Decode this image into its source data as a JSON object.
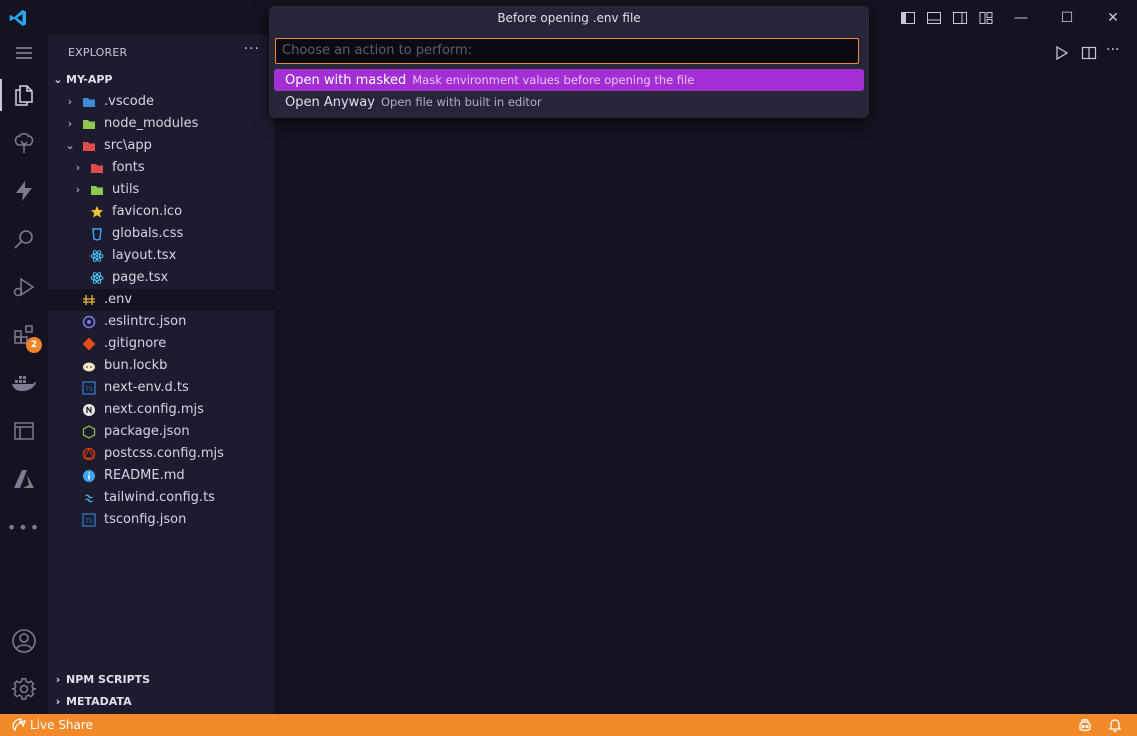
{
  "window": {
    "minimize": "—",
    "maximize": "☐",
    "close": "✕"
  },
  "activity_bar": {
    "items": [
      {
        "name": "explorer",
        "icon": "files-icon",
        "active": true
      },
      {
        "name": "source-control",
        "icon": "tree-icon"
      },
      {
        "name": "run",
        "icon": "lightning-icon"
      },
      {
        "name": "search",
        "icon": "search-icon"
      },
      {
        "name": "run-debug",
        "icon": "debug-icon"
      },
      {
        "name": "extensions",
        "icon": "extensions-icon",
        "badge": "2"
      },
      {
        "name": "docker",
        "icon": "docker-icon"
      },
      {
        "name": "remote",
        "icon": "window-icon"
      },
      {
        "name": "azure",
        "icon": "azure-icon"
      },
      {
        "name": "more",
        "icon": "ellipsis-icon"
      }
    ],
    "bottom": [
      {
        "name": "accounts",
        "icon": "account-icon"
      },
      {
        "name": "manage",
        "icon": "gear-icon"
      }
    ]
  },
  "sidebar": {
    "title": "EXPLORER",
    "more": "···",
    "project": "MY-APP",
    "tree": [
      {
        "label": ".vscode",
        "depth": 1,
        "chev": "›",
        "icon": "folder-vscode-icon",
        "color": "#3c8ad8"
      },
      {
        "label": "node_modules",
        "depth": 1,
        "chev": "›",
        "icon": "folder-node-icon",
        "color": "#8cc84b"
      },
      {
        "label": "src\\app",
        "depth": 1,
        "chev": "⌄",
        "icon": "folder-src-icon",
        "color": "#e24b4b"
      },
      {
        "label": "fonts",
        "depth": 2,
        "chev": "›",
        "icon": "folder-fonts-icon",
        "color": "#e24b4b"
      },
      {
        "label": "utils",
        "depth": 2,
        "chev": "›",
        "icon": "folder-utils-icon",
        "color": "#8cc84b"
      },
      {
        "label": "favicon.ico",
        "depth": 2,
        "icon": "star-icon",
        "color": "#f2c131"
      },
      {
        "label": "globals.css",
        "depth": 2,
        "icon": "css-icon",
        "color": "#42a5f5"
      },
      {
        "label": "layout.tsx",
        "depth": 2,
        "icon": "react-icon",
        "color": "#4fc3f7"
      },
      {
        "label": "page.tsx",
        "depth": 2,
        "icon": "react-icon",
        "color": "#4fc3f7"
      },
      {
        "label": ".env",
        "depth": 1,
        "icon": "env-icon",
        "color": "#f2c131",
        "selected": true
      },
      {
        "label": ".eslintrc.json",
        "depth": 1,
        "icon": "eslint-icon",
        "color": "#7a7ee8"
      },
      {
        "label": ".gitignore",
        "depth": 1,
        "icon": "git-icon",
        "color": "#e64a19"
      },
      {
        "label": "bun.lockb",
        "depth": 1,
        "icon": "bun-icon",
        "color": "#f5e6c8"
      },
      {
        "label": "next-env.d.ts",
        "depth": 1,
        "icon": "ts-icon",
        "color": "#3178c6"
      },
      {
        "label": "next.config.mjs",
        "depth": 1,
        "icon": "next-icon",
        "color": "#e8e8e8"
      },
      {
        "label": "package.json",
        "depth": 1,
        "icon": "nodejs-icon",
        "color": "#8cc84b"
      },
      {
        "label": "postcss.config.mjs",
        "depth": 1,
        "icon": "postcss-icon",
        "color": "#dd3a0a"
      },
      {
        "label": "README.md",
        "depth": 1,
        "icon": "info-icon",
        "color": "#42a5f5"
      },
      {
        "label": "tailwind.config.ts",
        "depth": 1,
        "icon": "tailwind-icon",
        "color": "#4fc3f7"
      },
      {
        "label": "tsconfig.json",
        "depth": 1,
        "icon": "tsconfig-icon",
        "color": "#3178c6"
      }
    ],
    "sections": [
      {
        "label": "NPM SCRIPTS"
      },
      {
        "label": "METADATA"
      }
    ]
  },
  "quick_pick": {
    "title": "Before opening .env file",
    "placeholder": "Choose an action to perform:",
    "value": "",
    "items": [
      {
        "label": "Open with masked",
        "description": "Mask environment values before opening the file",
        "active": true
      },
      {
        "label": "Open Anyway",
        "description": "Open file with built in editor"
      }
    ]
  },
  "editor_actions": {
    "run": "run-icon",
    "split": "split-editor-icon",
    "more": "···"
  },
  "status_bar": {
    "live_share": "Live Share",
    "accent": "#f28a2a"
  }
}
